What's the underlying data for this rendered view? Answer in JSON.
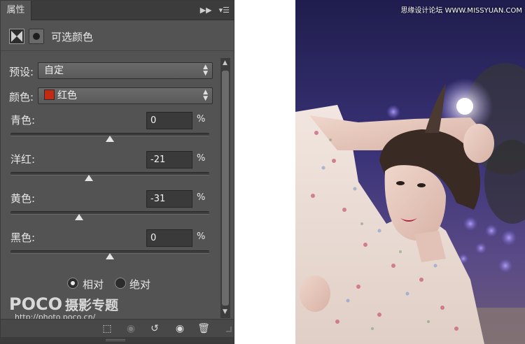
{
  "panel": {
    "tab_title": "属性",
    "collapse_icon": "double-chevron-right-icon",
    "menu_icon": "panel-menu-icon",
    "adjustment_title": "可选颜色",
    "preset": {
      "label": "预设:",
      "value": "自定"
    },
    "colors": {
      "label": "颜色:",
      "value": "红色",
      "swatch_color": "#c42a12"
    },
    "sliders": [
      {
        "label": "青色:",
        "value": "0",
        "unit": "%",
        "level": 0
      },
      {
        "label": "洋红:",
        "value": "-21",
        "unit": "%",
        "level": -21
      },
      {
        "label": "黄色:",
        "value": "-31",
        "unit": "%",
        "level": -31
      },
      {
        "label": "黑色:",
        "value": "0",
        "unit": "%",
        "level": 0
      }
    ],
    "method": {
      "relative_label": "相对",
      "absolute_label": "绝对",
      "selected": "relative"
    },
    "watermark": {
      "logo": "POCO",
      "logo_cn": "摄影专题",
      "url": "http://photo.poco.cn/"
    },
    "bottom_icons": [
      "clip-to-layer-icon",
      "view-previous-icon",
      "reset-icon",
      "visibility-eye-icon",
      "trash-icon"
    ]
  },
  "photo": {
    "caption": "思缘设计论坛 WWW.MISSYUAN.COM"
  }
}
